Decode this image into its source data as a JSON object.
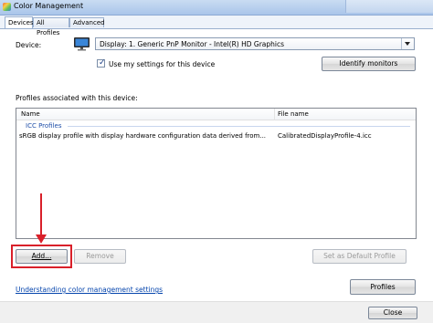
{
  "window": {
    "title": "Color Management"
  },
  "tabs": [
    {
      "label": "Devices",
      "active": true
    },
    {
      "label": "All Profiles",
      "active": false
    },
    {
      "label": "Advanced",
      "active": false
    }
  ],
  "device": {
    "label": "Device:",
    "selected": "Display: 1. Generic PnP Monitor - Intel(R) HD Graphics",
    "use_settings_checked": true,
    "use_settings_label": "Use my settings for this device",
    "identify_label": "Identify monitors"
  },
  "profiles": {
    "caption": "Profiles associated with this device:",
    "columns": {
      "name": "Name",
      "file": "File name"
    },
    "group": "ICC Profiles",
    "rows": [
      {
        "name": "sRGB display profile with display hardware configuration data derived from...",
        "file": "CalibratedDisplayProfile-4.icc"
      }
    ]
  },
  "buttons": {
    "add": "Add...",
    "remove": "Remove",
    "set_default": "Set as Default Profile",
    "profiles": "Profiles",
    "close": "Close"
  },
  "help_link": "Understanding color management settings",
  "colors": {
    "annotation": "#d9202a",
    "link": "#0645ad",
    "accent": "#1e4ea8"
  },
  "icons": [
    "color-management-icon",
    "monitor-icon",
    "checkmark-icon",
    "dropdown-arrow-icon",
    "red-arrow-annotation"
  ]
}
